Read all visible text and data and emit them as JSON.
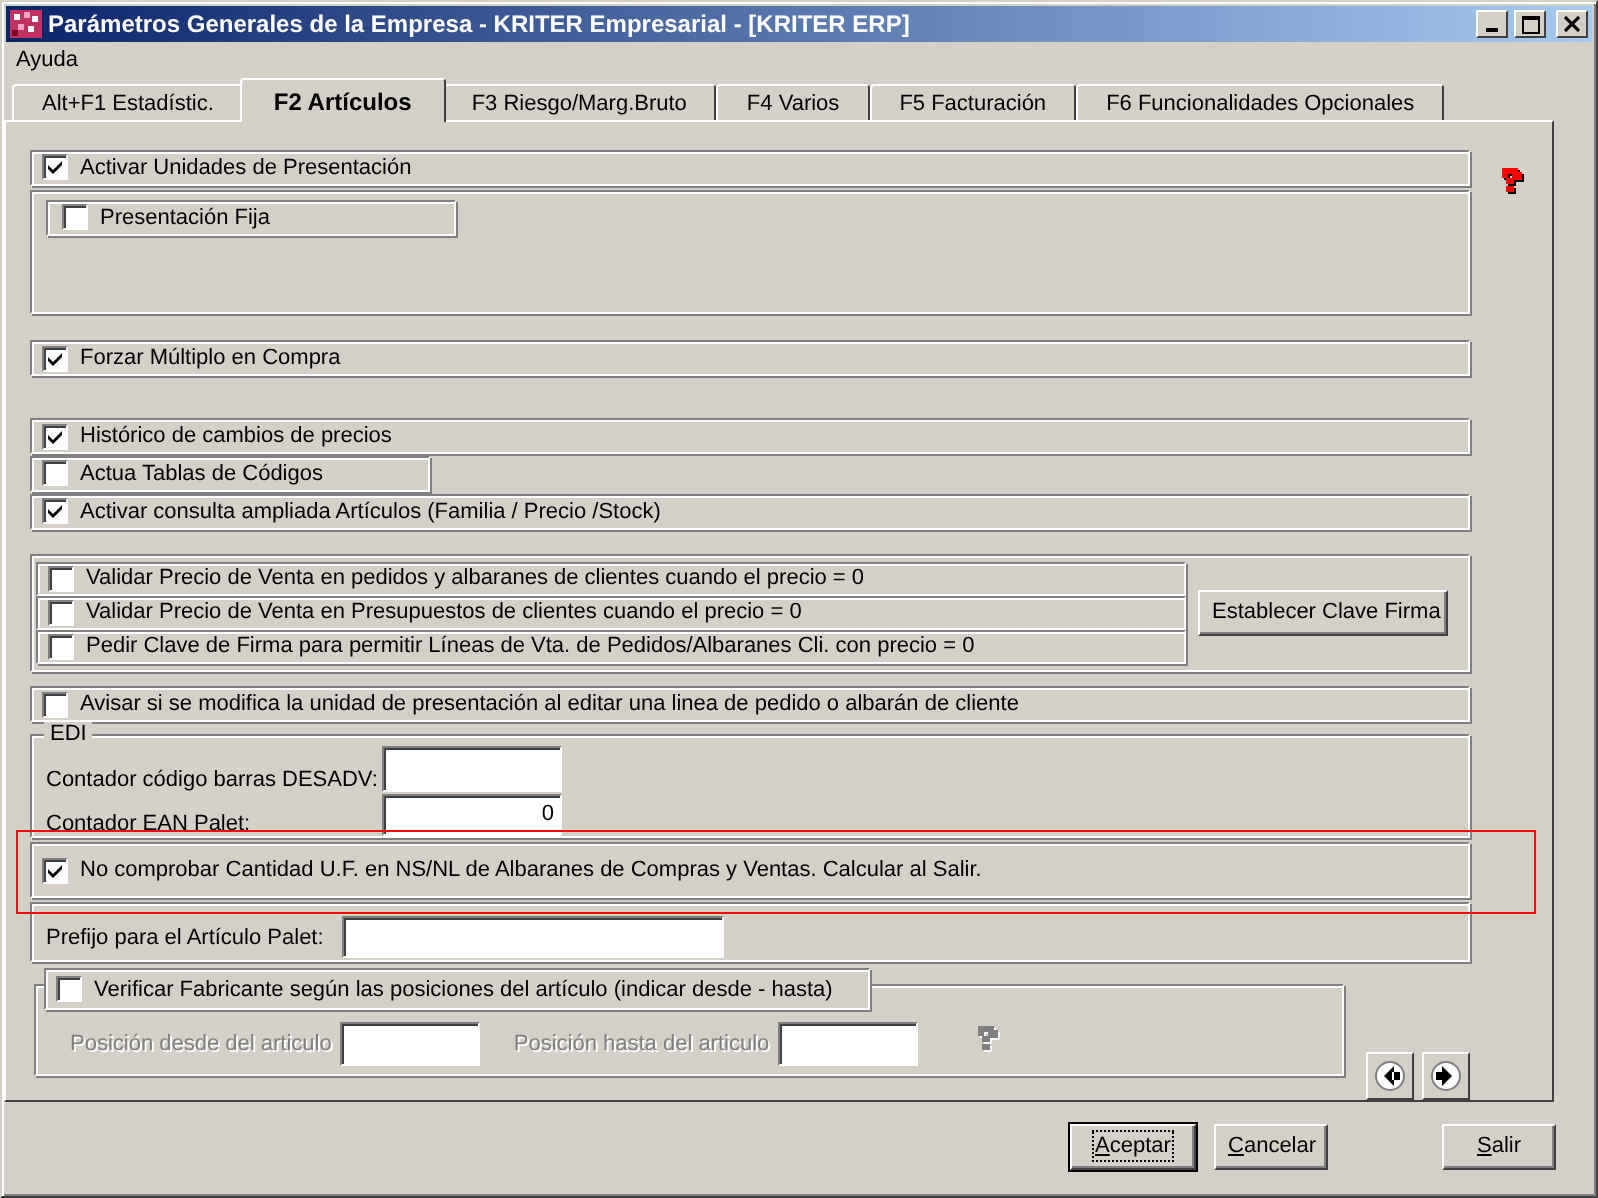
{
  "window": {
    "title": "Parámetros Generales de la Empresa - KRITER Empresarial - [KRITER ERP]"
  },
  "menu": [
    {
      "label": "Ayuda"
    }
  ],
  "tabs": [
    {
      "label": "Alt+F1 Estadístic.",
      "selected": false
    },
    {
      "label": "F2 Artículos",
      "selected": true
    },
    {
      "label": "F3 Riesgo/Marg.Bruto",
      "selected": false
    },
    {
      "label": "F4 Varios",
      "selected": false
    },
    {
      "label": "F5 Facturación",
      "selected": false
    },
    {
      "label": "F6 Funcionalidades Opcionales",
      "selected": false
    }
  ],
  "sections": [
    {
      "kind": "check",
      "label": "Activar Unidades de Presentación",
      "checked": true
    },
    {
      "kind": "subgroup",
      "items": [
        {
          "label": "Presentación Fija",
          "checked": false
        }
      ]
    },
    {
      "kind": "check",
      "label": "Forzar Múltiplo en Compra",
      "checked": true
    },
    {
      "kind": "check",
      "label": "Histórico de cambios de precios",
      "checked": true
    },
    {
      "kind": "short_check",
      "label": "Actua Tablas de Códigos",
      "checked": false
    },
    {
      "kind": "check",
      "label": "Activar consulta ampliada Artículos (Familia / Precio /Stock)",
      "checked": true
    },
    {
      "kind": "check_group",
      "items": [
        {
          "label": "Validar Precio de Venta en pedidos y albaranes de clientes cuando el precio = 0",
          "checked": false
        },
        {
          "label": "Validar Precio de Venta en Presupuestos de clientes cuando el precio = 0",
          "checked": false
        },
        {
          "label": "Pedir Clave de Firma para permitir Líneas de Vta. de Pedidos/Albaranes Cli. con precio = 0",
          "checked": false
        }
      ],
      "button": {
        "label": "Establecer Clave Firma"
      }
    },
    {
      "kind": "check",
      "label": "Avisar si se modifica la unidad de presentación al editar una linea de pedido o albarán de cliente",
      "checked": false
    },
    {
      "kind": "edi",
      "legend": "EDI",
      "fields": [
        {
          "label": "Contador código barras DESADV:"
        },
        {
          "label": "Contador EAN Palet:",
          "value": "0"
        }
      ]
    },
    {
      "kind": "tall_check",
      "label": "No comprobar Cantidad U.F. en NS/NL de Albaranes de Compras y Ventas. Calcular al Salir.",
      "checked": true,
      "highlighted": true
    },
    {
      "kind": "field",
      "label": "Prefijo para el Artículo Palet:"
    },
    {
      "kind": "range",
      "check": {
        "label": "Verificar Fabricante según las posiciones del artículo (indicar desde - hasta)",
        "checked": false
      },
      "fields": [
        {
          "label": "Posición desde del articulo",
          "disabled": true
        },
        {
          "label": "Posición hasta del articulo",
          "disabled": true
        }
      ]
    }
  ],
  "buttons": [
    {
      "label": "Aceptar",
      "default": true,
      "mnemonic": true
    },
    {
      "label": "Cancelar",
      "default": false,
      "mnemonic": true
    },
    {
      "label": "Salir",
      "default": false,
      "mnemonic": true
    }
  ]
}
